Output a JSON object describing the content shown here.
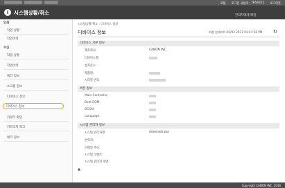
{
  "topbar": {
    "portal": "포털",
    "login_user_label": "로그인 사용자:",
    "login_user_value": "7654321",
    "logout": "로그아웃"
  },
  "header": {
    "logo": "i",
    "title": "시스템상황/취소",
    "admin_mail": "관리자에게 메일"
  },
  "sidebar": {
    "sections": [
      {
        "heading": "인쇄",
        "items": [
          "작업 상황",
          "작업이력"
        ]
      },
      {
        "heading": "수신",
        "items": [
          "작업 상황",
          "작업이력",
          "에러 정보",
          "소모품 정보",
          "디바이스 정보",
          "디바이스 정보",
          "카운터 확인",
          "카트리지 로그",
          "에코 정보"
        ]
      }
    ]
  },
  "main": {
    "breadcrumb": "시스템상황/취소 : 디바이스 정보",
    "title": "디바이스 정보",
    "updated": "최종 업데이트:02/02 2017 01:47:26 PM",
    "refresh_icon": "↻",
    "sections": [
      {
        "title": "디바이스 기본 정보",
        "rows": [
          {
            "label": "제조회사:",
            "value": "CANON INC."
          },
          {
            "label": "디바이스명:",
            "value": ""
          },
          {
            "label": "설치장소:",
            "value": ""
          },
          {
            "label": "제품명:",
            "value": ""
          },
          {
            "label": "시리얼 번호:",
            "value": ""
          }
        ]
      },
      {
        "title": "버전 정보",
        "rows": [
          {
            "label": "Main Controller:",
            "value": ""
          },
          {
            "label": "Boot ROM:",
            "value": ""
          },
          {
            "label": "DCON:",
            "value": ""
          },
          {
            "label": "Language:",
            "value": ""
          }
        ]
      },
      {
        "title": "시스템 관리자 정보",
        "rows": [
          {
            "label": "시스템 관리자명:",
            "value": "Administrator"
          },
          {
            "label": "연락처:",
            "value": ""
          },
          {
            "label": "이메일 주소:",
            "value": ""
          },
          {
            "label": "시스템 코멘트:",
            "value": ""
          },
          {
            "label": "시스템 관리자 설명:",
            "value": ""
          }
        ]
      }
    ],
    "to_top_icon": "▲"
  },
  "footer": {
    "copyright": "Copyright CANON INC. 2016"
  },
  "colors": {
    "highlight": "#f2a000",
    "header_bg": "#3e3e3e"
  }
}
